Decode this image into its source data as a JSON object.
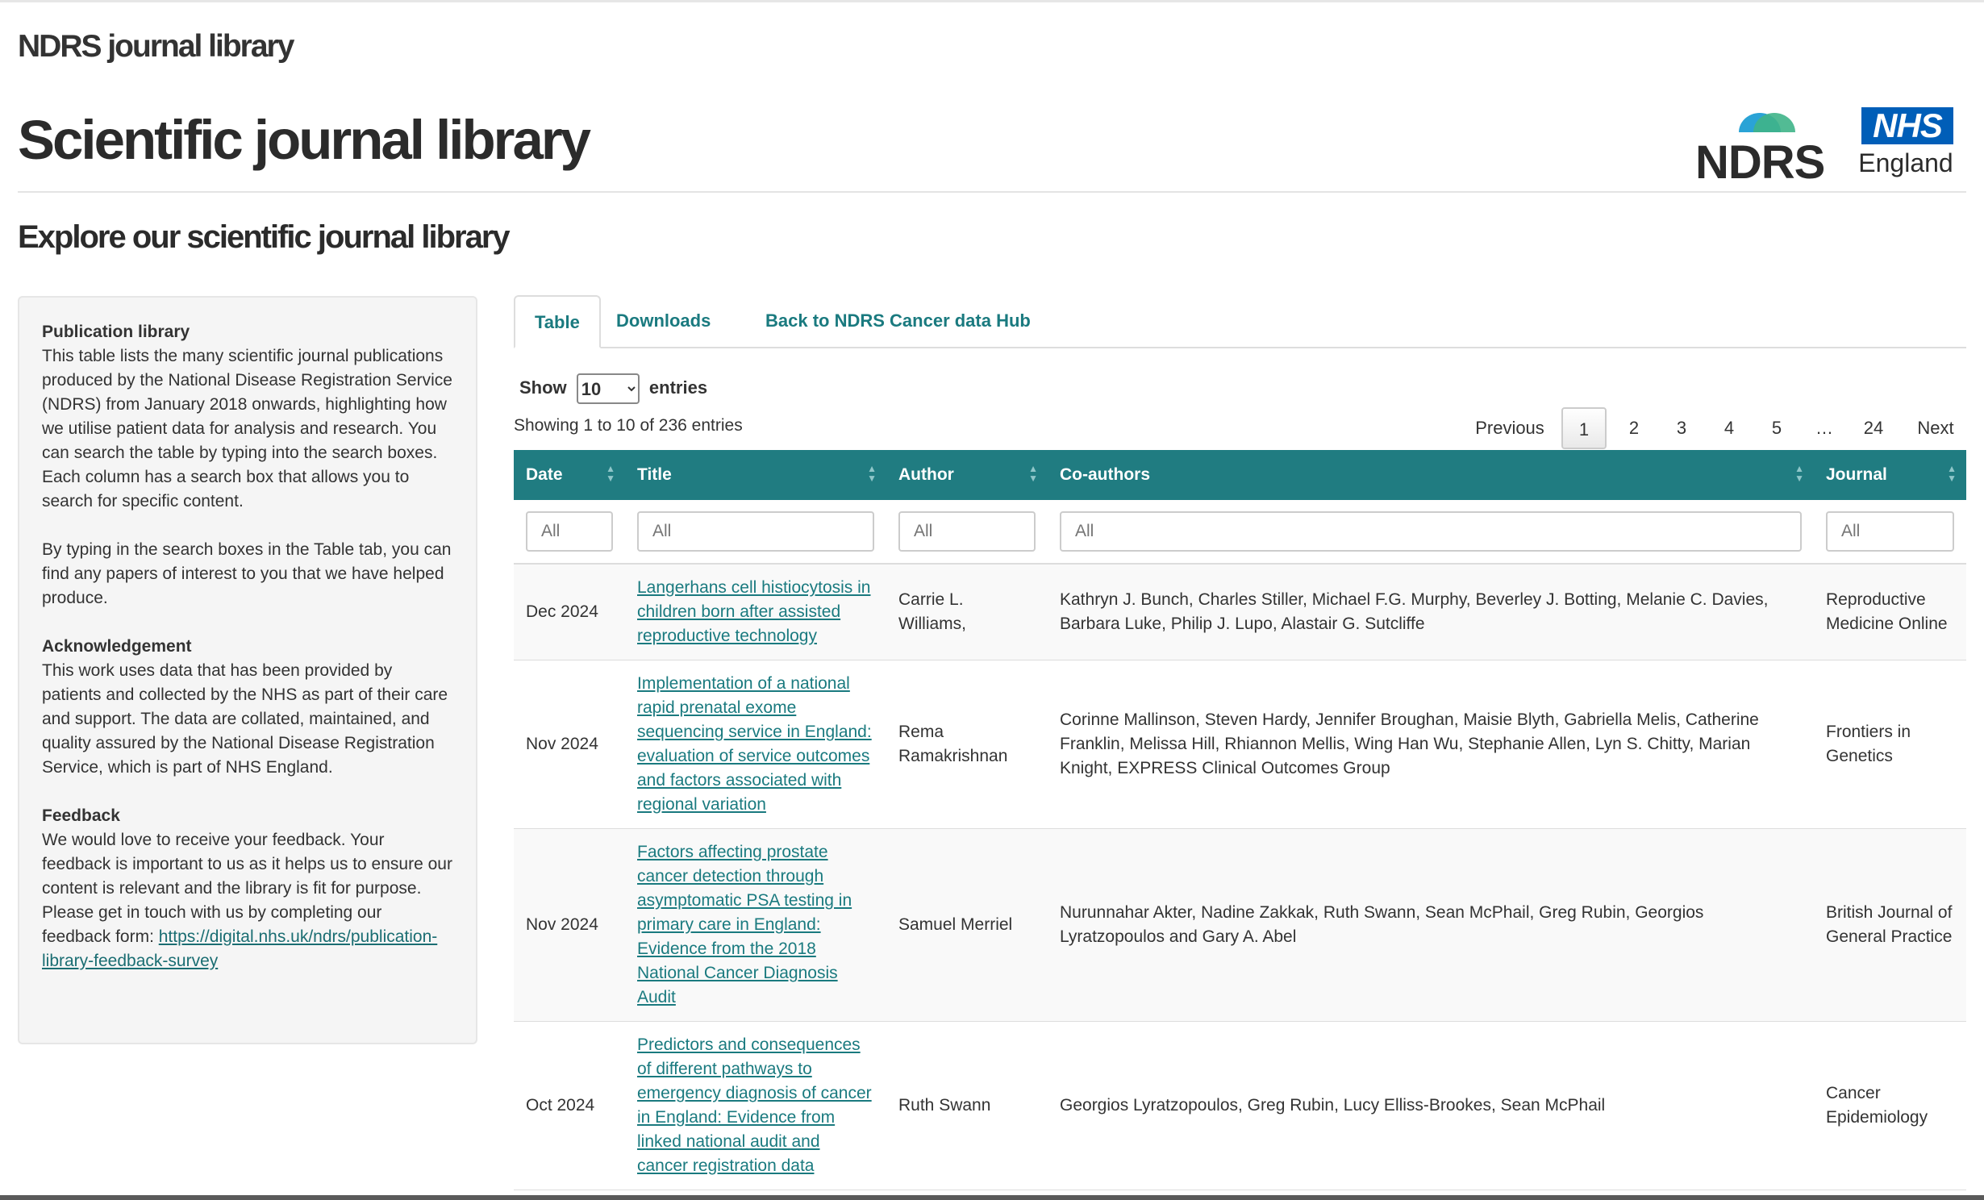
{
  "header": {
    "app_title": "NDRS journal library",
    "page_title": "Scientific journal library",
    "subtitle": "Explore our scientific journal library"
  },
  "logos": {
    "ndrs": "NDRS",
    "nhs": "NHS",
    "nhs_sub": "England",
    "ndrs_arc_colors": [
      "#2aa3d6",
      "#3fb488"
    ],
    "nhs_blue": "#005eb8"
  },
  "sidebar": {
    "publication_heading": "Publication library",
    "publication_text": "This table lists the many scientific journal publications produced by the National Disease Registration Service (NDRS) from January 2018 onwards, highlighting how we utilise patient data for analysis and research. You can search the table by typing into the search boxes. Each column has a search box that allows you to search for specific content.",
    "search_text": "By typing in the search boxes in the Table tab, you can find any papers of interest to you that we have helped produce.",
    "ack_heading": "Acknowledgement",
    "ack_text": "This work uses data that has been provided by patients and collected by the NHS as part of their care and support. The data are collated, maintained, and quality assured by the National Disease Registration Service, which is part of NHS England.",
    "feedback_heading": "Feedback",
    "feedback_text": "We would love to receive your feedback. Your feedback is important to us as it helps us to ensure our content is relevant and the library is fit for purpose. Please get in touch with us by completing our feedback form: ",
    "feedback_link": "https://digital.nhs.uk/ndrs/publication-library-feedback-survey"
  },
  "tabs": [
    "Table",
    "Downloads",
    "Back to NDRS Cancer data Hub"
  ],
  "table_controls": {
    "show_label": "Show",
    "entries_label": "entries",
    "page_length": "10",
    "info": "Showing 1 to 10 of 236 entries"
  },
  "pagination": {
    "previous": "Previous",
    "pages": [
      "1",
      "2",
      "3",
      "4",
      "5",
      "…",
      "24"
    ],
    "next": "Next",
    "current": "1"
  },
  "table": {
    "columns": [
      "Date",
      "Title",
      "Author",
      "Co-authors",
      "Journal"
    ],
    "filter_placeholders": [
      "All",
      "All",
      "All",
      "All",
      "All"
    ],
    "rows": [
      {
        "date": "Dec 2024",
        "title": "Langerhans cell histiocytosis in children born after assisted reproductive technology",
        "author": "Carrie L. Williams,",
        "coauthors": "Kathryn J. Bunch, Charles Stiller, Michael F.G. Murphy, Beverley J. Botting, Melanie C. Davies, Barbara Luke, Philip J. Lupo, Alastair G. Sutcliffe",
        "journal": "Reproductive Medicine Online"
      },
      {
        "date": "Nov 2024",
        "title": "Implementation of a national rapid prenatal exome sequencing service in England: evaluation of service outcomes and factors associated with regional variation",
        "author": "Rema Ramakrishnan",
        "coauthors": "Corinne Mallinson, Steven Hardy, Jennifer Broughan, Maisie Blyth, Gabriella Melis, Catherine Franklin, Melissa Hill, Rhiannon Mellis, Wing Han Wu, Stephanie Allen, Lyn S. Chitty, Marian Knight, EXPRESS Clinical Outcomes Group",
        "journal": "Frontiers in Genetics"
      },
      {
        "date": "Nov 2024",
        "title": "Factors affecting prostate cancer detection through asymptomatic PSA testing in primary care in England: Evidence from the 2018 National Cancer Diagnosis Audit",
        "author": "Samuel Merriel",
        "coauthors": "Nurunnahar Akter, Nadine Zakkak, Ruth Swann, Sean McPhail, Greg Rubin, Georgios Lyratzopoulos and Gary A. Abel",
        "journal": "British Journal of General Practice"
      },
      {
        "date": "Oct 2024",
        "title": "Predictors and consequences of different pathways to emergency diagnosis of cancer in England: Evidence from linked national audit and cancer registration data",
        "author": "Ruth Swann",
        "coauthors": "Georgios Lyratzopoulos, Greg Rubin, Lucy Elliss-Brookes, Sean McPhail",
        "journal": "Cancer Epidemiology"
      }
    ]
  }
}
